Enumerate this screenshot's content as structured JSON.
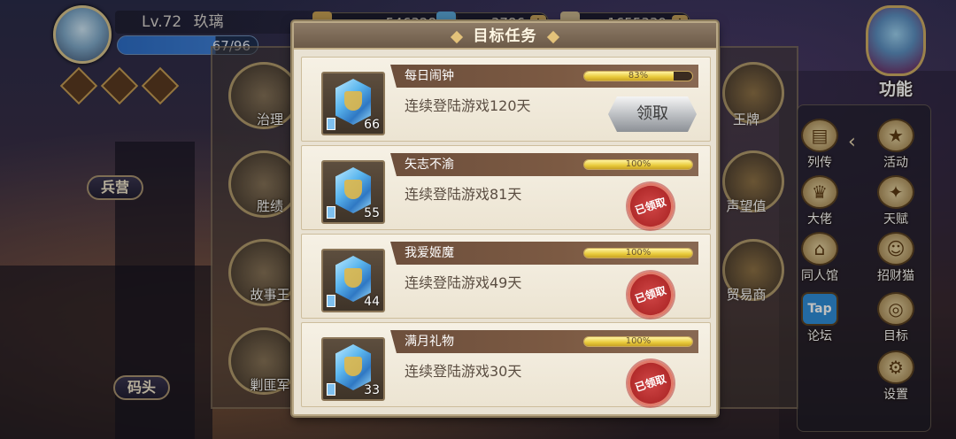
{
  "player": {
    "level": "Lv.72",
    "name": "玖璃",
    "energy": "67/96"
  },
  "resources": [
    {
      "value": "546328",
      "icon": "coin-icon"
    },
    {
      "value": "3786",
      "icon": "gem-icon"
    },
    {
      "value": "1655339",
      "icon": "feather-icon"
    }
  ],
  "map_tags": [
    "兵营",
    "码头"
  ],
  "left_buildings": [
    "治理",
    "胜绩",
    "故事王",
    "剿匪军"
  ],
  "right_buildings": [
    "王牌",
    "声望值",
    "贸易商"
  ],
  "functions": {
    "main_label": "功能",
    "items": [
      {
        "label": "列传",
        "icon": "book-icon"
      },
      {
        "label": "活动",
        "icon": "star-badge-icon"
      },
      {
        "label": "大佬",
        "icon": "boss-icon"
      },
      {
        "label": "天赋",
        "icon": "talent-icon"
      },
      {
        "label": "同人馆",
        "icon": "gallery-icon"
      },
      {
        "label": "招财猫",
        "icon": "lucky-cat-icon"
      },
      {
        "label": "论坛",
        "icon": "tap-forum-icon",
        "badge": "Tap"
      },
      {
        "label": "目标",
        "icon": "target-icon"
      },
      {
        "label": "设置",
        "icon": "gear-icon"
      }
    ]
  },
  "dialog": {
    "title": "目标任务",
    "tasks": [
      {
        "name": "每日闹钟",
        "description": "连续登陆游戏120天",
        "progress_text": "83%",
        "progress": 0.83,
        "reward_count": "66",
        "status": "claimable",
        "claim_label": "领取"
      },
      {
        "name": "矢志不渝",
        "description": "连续登陆游戏81天",
        "progress_text": "100%",
        "progress": 1.0,
        "reward_count": "55",
        "status": "claimed",
        "claimed_label": "已领取"
      },
      {
        "name": "我爱姬魔",
        "description": "连续登陆游戏49天",
        "progress_text": "100%",
        "progress": 1.0,
        "reward_count": "44",
        "status": "claimed",
        "claimed_label": "已领取"
      },
      {
        "name": "满月礼物",
        "description": "连续登陆游戏30天",
        "progress_text": "100%",
        "progress": 1.0,
        "reward_count": "33",
        "status": "claimed",
        "claimed_label": "已领取"
      }
    ]
  },
  "colors": {
    "dialog_bg": "#e9e2d3",
    "banner": "#6d4f3c",
    "progress_fill": "#e8c93a",
    "stamp_red": "#b22b2b"
  }
}
